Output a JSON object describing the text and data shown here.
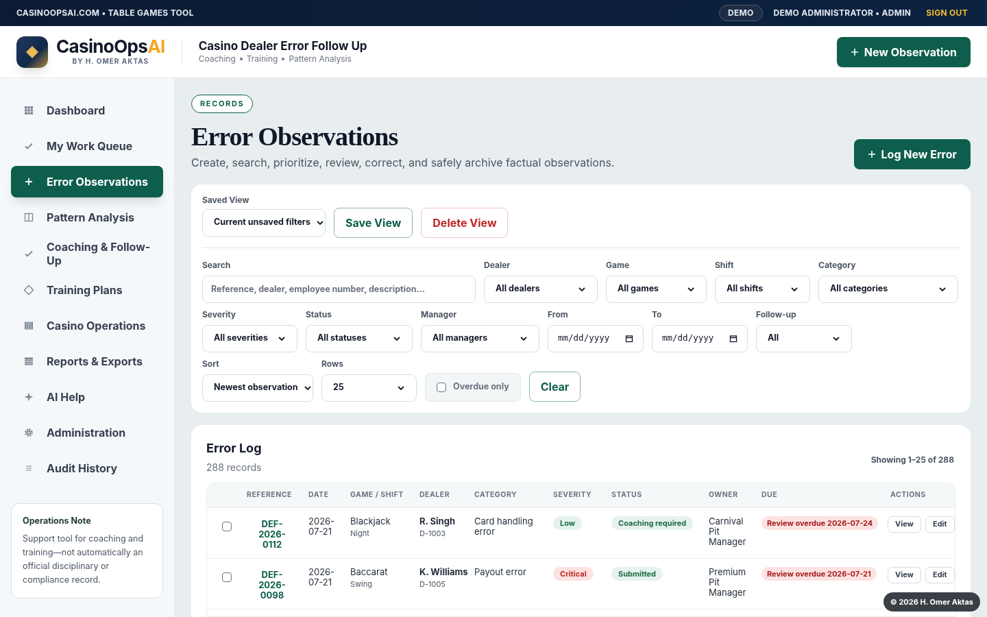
{
  "top_bar": {
    "site": "CASINOOPSAI.COM • TABLE GAMES TOOL",
    "mode_badge": "DEMO",
    "user": "DEMO ADMINISTRATOR • ADMIN",
    "sign_out": "SIGN OUT"
  },
  "header": {
    "brand": "CasinoOps",
    "brand_accent": "AI",
    "byline": "BY H. OMER AKTAS",
    "title": "Casino Dealer Error Follow Up",
    "subtitle_parts": [
      "Coaching",
      "Training",
      "Pattern Analysis"
    ],
    "new_button": "New Observation"
  },
  "sidebar": {
    "items": [
      {
        "label": "Dashboard",
        "selected": false
      },
      {
        "label": "My Work Queue",
        "selected": false
      },
      {
        "label": "Error Observations",
        "selected": true
      },
      {
        "label": "Pattern Analysis",
        "selected": false
      },
      {
        "label": "Coaching & Follow-Up",
        "selected": false
      },
      {
        "label": "Training Plans",
        "selected": false
      },
      {
        "label": "Casino Operations",
        "selected": false
      },
      {
        "label": "Reports & Exports",
        "selected": false
      },
      {
        "label": "AI Help",
        "selected": false
      },
      {
        "label": "Administration",
        "selected": false
      },
      {
        "label": "Audit History",
        "selected": false
      }
    ],
    "note": {
      "title": "Operations Note",
      "text": "Support tool for coaching and training—not automatically an official disciplinary or compliance record."
    }
  },
  "page": {
    "eyebrow": "RECORDS",
    "title": "Error Observations",
    "description": "Create, search, prioritize, review, correct, and safely archive factual observations.",
    "log_button": "Log New Error"
  },
  "filters": {
    "saved_view": {
      "label": "Saved View",
      "value": "Current unsaved filters"
    },
    "save_view": "Save View",
    "delete_view": "Delete View",
    "search": {
      "label": "Search",
      "placeholder": "Reference, dealer, employee number, description…"
    },
    "row1": [
      {
        "label": "Dealer",
        "value": "All dealers"
      },
      {
        "label": "Game",
        "value": "All games"
      },
      {
        "label": "Shift",
        "value": "All shifts"
      },
      {
        "label": "Category",
        "value": "All categories"
      }
    ],
    "row2": [
      {
        "label": "Severity",
        "value": "All severities",
        "kind": "select"
      },
      {
        "label": "Status",
        "value": "All statuses",
        "kind": "select"
      },
      {
        "label": "Manager",
        "value": "All managers",
        "kind": "select"
      },
      {
        "label": "From",
        "value": "mm/dd/yyyy",
        "kind": "date"
      },
      {
        "label": "To",
        "value": "mm/dd/yyyy",
        "kind": "date"
      },
      {
        "label": "Follow-up",
        "value": "All",
        "kind": "select"
      }
    ],
    "sort": {
      "label": "Sort",
      "value": "Newest observation"
    },
    "rows": {
      "label": "Rows",
      "value": "25"
    },
    "overdue_only": {
      "label": "Overdue only",
      "checked": false
    },
    "clear": "Clear"
  },
  "error_log": {
    "title": "Error Log",
    "count": "288 records",
    "showing": "Showing 1–25 of 288",
    "columns": [
      "REFERENCE",
      "DATE",
      "GAME / SHIFT",
      "DEALER",
      "CATEGORY",
      "SEVERITY",
      "STATUS",
      "OWNER",
      "DUE",
      "ACTIONS"
    ],
    "rows": [
      {
        "checked": false,
        "reference": "DEF-2026-0112",
        "date": "2026-07-21",
        "game": "Blackjack",
        "shift": "Night",
        "dealer": "R. Singh",
        "employee": "D-1003",
        "category": "Card handling error",
        "severity": {
          "label": "Low",
          "color": "#e3f4ea"
        },
        "status": "Coaching required",
        "owner": "Carnival Pit Manager",
        "due": "Review overdue 2026-07-24",
        "actions": [
          "View",
          "Edit"
        ]
      },
      {
        "checked": false,
        "reference": "DEF-2026-0098",
        "date": "2026-07-21",
        "game": "Baccarat",
        "shift": "Swing",
        "dealer": "K. Williams",
        "employee": "D-1005",
        "category": "Payout error",
        "severity": {
          "label": "Critical",
          "color": "#fde2e2"
        },
        "status": "Submitted",
        "owner": "Premium Pit Manager",
        "due": "Review overdue 2026-07-21",
        "actions": [
          "View",
          "Edit"
        ]
      }
    ]
  },
  "footer_badge": "© 2026 H. Omer Aktas"
}
